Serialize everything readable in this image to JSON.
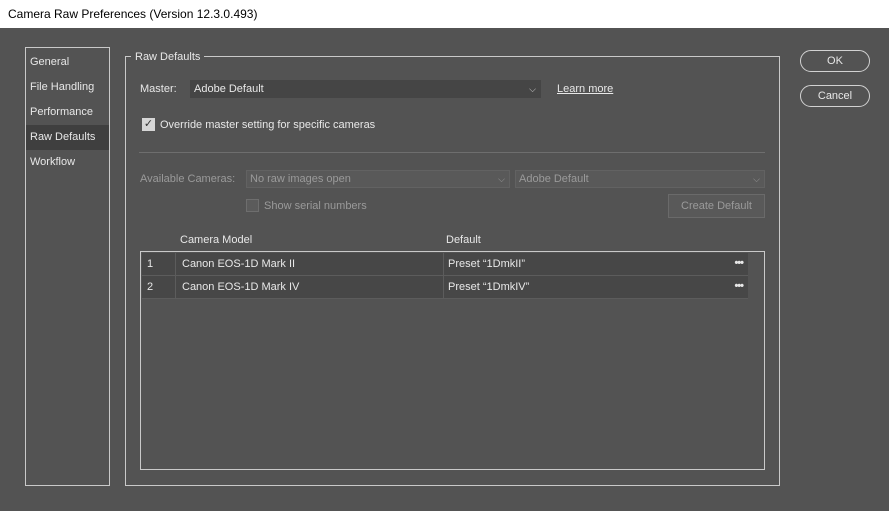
{
  "window": {
    "title": "Camera Raw Preferences  (Version 12.3.0.493)"
  },
  "sidebar": {
    "items": [
      {
        "label": "General"
      },
      {
        "label": "File Handling"
      },
      {
        "label": "Performance"
      },
      {
        "label": "Raw Defaults",
        "active": true
      },
      {
        "label": "Workflow"
      }
    ]
  },
  "raw_defaults": {
    "legend": "Raw Defaults",
    "master_label": "Master:",
    "master_value": "Adobe Default",
    "learn_more": "Learn more",
    "override_label": "Override master setting for specific cameras",
    "override_checked": true,
    "available_cameras_label": "Available Cameras:",
    "available_cameras_value": "No raw images open",
    "camera_default_value": "Adobe Default",
    "show_serial_label": "Show serial numbers",
    "create_default_label": "Create Default"
  },
  "table": {
    "headers": {
      "model": "Camera Model",
      "default": "Default"
    },
    "rows": [
      {
        "num": "1",
        "model": "Canon EOS-1D Mark II",
        "default": "Preset “1DmkII”",
        "menu": "•••"
      },
      {
        "num": "2",
        "model": "Canon EOS-1D Mark IV",
        "default": "Preset “1DmkIV”",
        "menu": "•••"
      }
    ]
  },
  "buttons": {
    "ok": "OK",
    "cancel": "Cancel"
  },
  "icons": {
    "dropdown": "chevron-down-icon",
    "check": "checkmark-icon",
    "more": "more-dots-icon"
  }
}
